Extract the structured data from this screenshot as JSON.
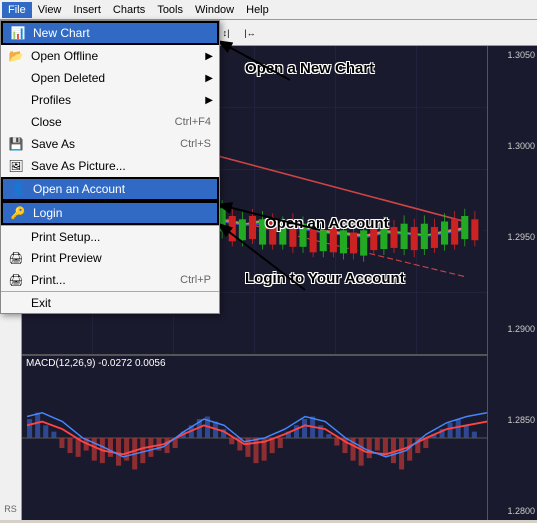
{
  "menubar": {
    "items": [
      "File",
      "View",
      "Insert",
      "Charts",
      "Tools",
      "Window",
      "Help"
    ],
    "active": "File"
  },
  "dropdown": {
    "items": [
      {
        "label": "New Chart",
        "shortcut": "",
        "hasArrow": false,
        "highlighted": true,
        "icon": "chart-icon",
        "separatorAbove": false
      },
      {
        "label": "Open Offline",
        "shortcut": "",
        "hasArrow": true,
        "highlighted": false,
        "icon": "folder-icon",
        "separatorAbove": false
      },
      {
        "label": "Open Deleted",
        "shortcut": "",
        "hasArrow": true,
        "highlighted": false,
        "icon": "",
        "separatorAbove": false
      },
      {
        "label": "Profiles",
        "shortcut": "",
        "hasArrow": true,
        "highlighted": false,
        "icon": "",
        "separatorAbove": false
      },
      {
        "label": "Close",
        "shortcut": "Ctrl+F4",
        "hasArrow": false,
        "highlighted": false,
        "icon": "",
        "separatorAbove": false
      },
      {
        "label": "Save As",
        "shortcut": "Ctrl+S",
        "hasArrow": false,
        "highlighted": false,
        "icon": "save-icon",
        "separatorAbove": false
      },
      {
        "label": "Save As Picture...",
        "shortcut": "",
        "hasArrow": false,
        "highlighted": false,
        "icon": "savepic-icon",
        "separatorAbove": false
      },
      {
        "label": "Open an Account",
        "shortcut": "",
        "hasArrow": false,
        "highlighted": true,
        "icon": "person-icon",
        "separatorAbove": false
      },
      {
        "label": "Login",
        "shortcut": "",
        "hasArrow": false,
        "highlighted": true,
        "icon": "key-icon",
        "separatorAbove": false
      },
      {
        "label": "Print Setup...",
        "shortcut": "",
        "hasArrow": false,
        "highlighted": false,
        "icon": "",
        "separatorAbove": true
      },
      {
        "label": "Print Preview",
        "shortcut": "",
        "hasArrow": false,
        "highlighted": false,
        "icon": "print-icon",
        "separatorAbove": false
      },
      {
        "label": "Print...",
        "shortcut": "Ctrl+P",
        "hasArrow": false,
        "highlighted": false,
        "icon": "print2-icon",
        "separatorAbove": false
      },
      {
        "label": "Exit",
        "shortcut": "",
        "hasArrow": false,
        "highlighted": false,
        "icon": "",
        "separatorAbove": true
      }
    ]
  },
  "annotations": {
    "newChart": "Open a New Chart",
    "openAccount": "Open an Account",
    "login": "Login to Your Account"
  },
  "macd": {
    "label": "MACD(12,26,9) -0.0272 0.0056"
  },
  "priceLabels": [
    "1.3050",
    "1.3000",
    "1.2950",
    "1.2900",
    "1.2850",
    "1.2800"
  ]
}
